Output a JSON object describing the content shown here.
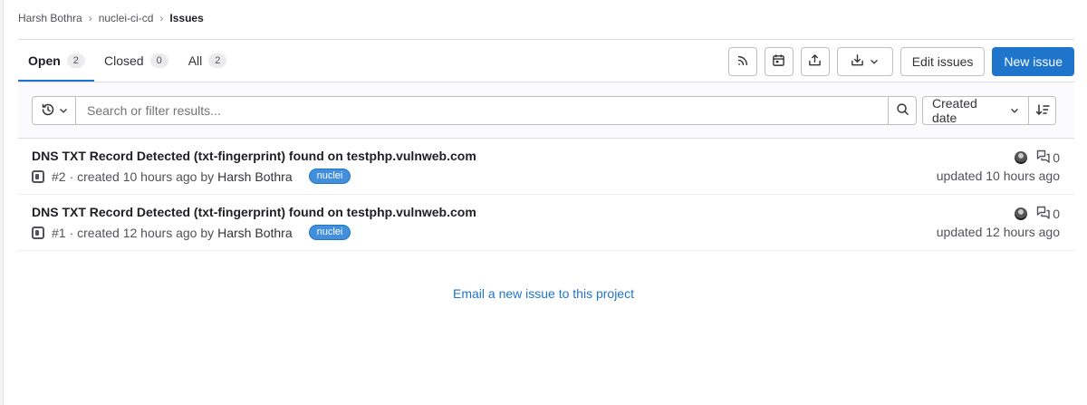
{
  "breadcrumb": {
    "items": [
      "Harsh Bothra",
      "nuclei-ci-cd",
      "Issues"
    ],
    "separator": "›"
  },
  "tabs": [
    {
      "label": "Open",
      "count": "2"
    },
    {
      "label": "Closed",
      "count": "0"
    },
    {
      "label": "All",
      "count": "2"
    }
  ],
  "toolbar": {
    "rss_icon": "rss-icon",
    "calendar_icon": "calendar-icon",
    "import_icon": "upload-icon",
    "export_icon": "download-icon",
    "edit_label": "Edit issues",
    "new_label": "New issue"
  },
  "filter": {
    "placeholder": "Search or filter results...",
    "sort_label": "Created date"
  },
  "issues": [
    {
      "title": "DNS TXT Record Detected (txt-fingerprint) found on testphp.vulnweb.com",
      "ref": "#2",
      "created": "· created 10 hours ago by",
      "author": "Harsh Bothra",
      "label": "nuclei",
      "comments": "0",
      "updated": "updated 10 hours ago"
    },
    {
      "title": "DNS TXT Record Detected (txt-fingerprint) found on testphp.vulnweb.com",
      "ref": "#1",
      "created": "· created 12 hours ago by",
      "author": "Harsh Bothra",
      "label": "nuclei",
      "comments": "0",
      "updated": "updated 12 hours ago"
    }
  ],
  "email_link": "Email a new issue to this project",
  "colors": {
    "accent": "#1f75cb",
    "label": "#428fdc"
  }
}
